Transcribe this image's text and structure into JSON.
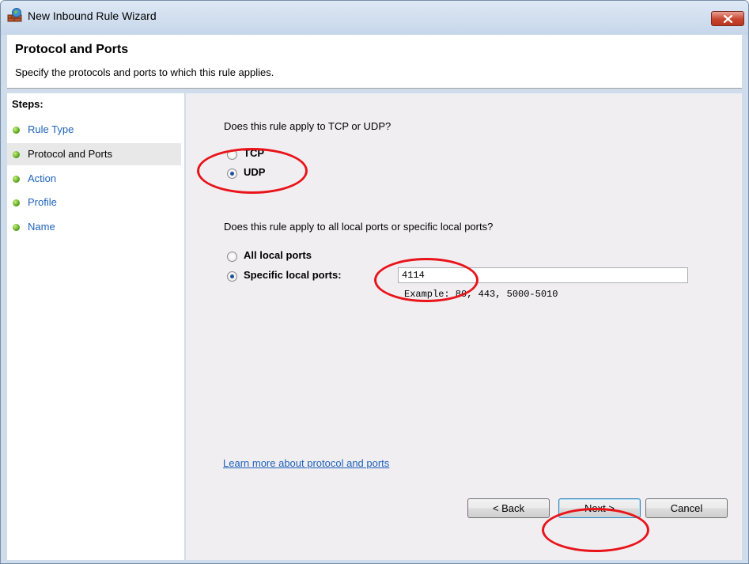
{
  "window": {
    "title": "New Inbound Rule Wizard"
  },
  "header": {
    "title": "Protocol and Ports",
    "subtitle": "Specify the protocols and ports to which this rule applies."
  },
  "steps": {
    "title": "Steps:",
    "items": [
      {
        "label": "Rule Type",
        "active": false
      },
      {
        "label": "Protocol and Ports",
        "active": true
      },
      {
        "label": "Action",
        "active": false
      },
      {
        "label": "Profile",
        "active": false
      },
      {
        "label": "Name",
        "active": false
      }
    ]
  },
  "protocol": {
    "question": "Does this rule apply to TCP or UDP?",
    "tcp_label": "TCP",
    "udp_label": "UDP",
    "selected": "UDP"
  },
  "ports": {
    "question": "Does this rule apply to all local ports or specific local ports?",
    "all_label": "All local ports",
    "specific_label": "Specific local ports:",
    "selected": "Specific local ports",
    "value": "4114",
    "example": "Example: 80, 443, 5000-5010"
  },
  "link": {
    "label": "Learn more about protocol and ports"
  },
  "buttons": {
    "back": "< Back",
    "next": "Next >",
    "cancel": "Cancel"
  },
  "colors": {
    "link": "#1e62b8",
    "annotation": "#e8141a",
    "step_dot": "#4c9a14"
  }
}
